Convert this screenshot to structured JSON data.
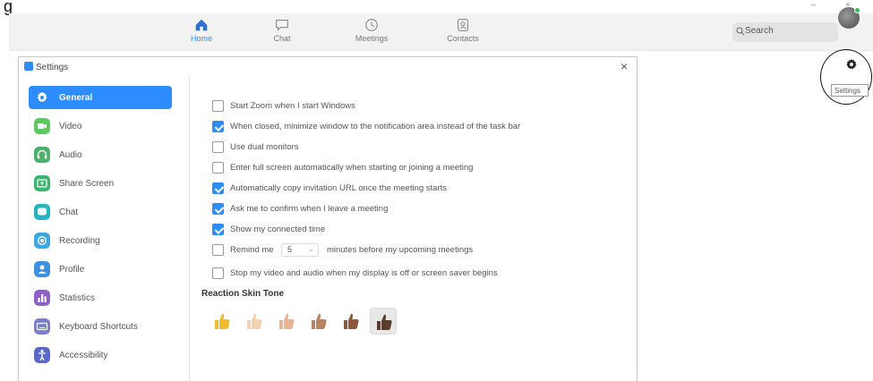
{
  "window": {
    "title_fragment": "g",
    "controls": [
      "–",
      "×"
    ]
  },
  "nav": {
    "tabs": [
      {
        "label": "Home",
        "icon": "home-icon",
        "active": true
      },
      {
        "label": "Chat",
        "icon": "chat-icon",
        "active": false
      },
      {
        "label": "Meetings",
        "icon": "clock-icon",
        "active": false
      },
      {
        "label": "Contacts",
        "icon": "contacts-icon",
        "active": false
      }
    ],
    "search_placeholder": "Search",
    "settings_tooltip": "Settings"
  },
  "settings": {
    "title": "Settings",
    "close_symbol": "×",
    "sidebar": [
      {
        "label": "General",
        "icon": "gear-icon",
        "color": "#2D8CFF",
        "active": true
      },
      {
        "label": "Video",
        "icon": "video-icon",
        "color": "#5FC75F"
      },
      {
        "label": "Audio",
        "icon": "headphones-icon",
        "color": "#4CAF6A"
      },
      {
        "label": "Share Screen",
        "icon": "share-screen-icon",
        "color": "#3BB46E"
      },
      {
        "label": "Chat",
        "icon": "chat-bubble-icon",
        "color": "#27B3C2"
      },
      {
        "label": "Recording",
        "icon": "record-icon",
        "color": "#3FA6E6"
      },
      {
        "label": "Profile",
        "icon": "profile-icon",
        "color": "#3D8FE0"
      },
      {
        "label": "Statistics",
        "icon": "statistics-icon",
        "color": "#8E5FC4"
      },
      {
        "label": "Keyboard Shortcuts",
        "icon": "keyboard-icon",
        "color": "#7A7FC8"
      },
      {
        "label": "Accessibility",
        "icon": "accessibility-icon",
        "color": "#5A69C7"
      }
    ],
    "options": [
      {
        "label": "Start Zoom when I start Windows",
        "checked": false
      },
      {
        "label": "When closed, minimize window to the notification area instead of the task bar",
        "checked": true
      },
      {
        "label": "Use dual monitors",
        "checked": false
      },
      {
        "label": "Enter full screen automatically when starting or joining a meeting",
        "checked": false
      },
      {
        "label": "Automatically copy invitation URL once the meeting starts",
        "checked": true
      },
      {
        "label": "Ask me to confirm when I leave a meeting",
        "checked": true
      },
      {
        "label": "Show my connected time",
        "checked": true
      }
    ],
    "remind": {
      "before": "Remind me",
      "minutes": "5",
      "after": "minutes before my upcoming meetings",
      "checked": false
    },
    "stop_video": {
      "label": "Stop my video and audio when my display is off or screen saver begins",
      "checked": false
    },
    "skin_tone_heading": "Reaction Skin Tone",
    "skin_tones": [
      "#F4B92E",
      "#F3D1B5",
      "#E6B395",
      "#B88462",
      "#8A5A3E",
      "#5A3C2C"
    ],
    "selected_skin_tone": 6
  },
  "colors": {
    "accent": "#2D8CFF",
    "online": "#2fc25b"
  }
}
